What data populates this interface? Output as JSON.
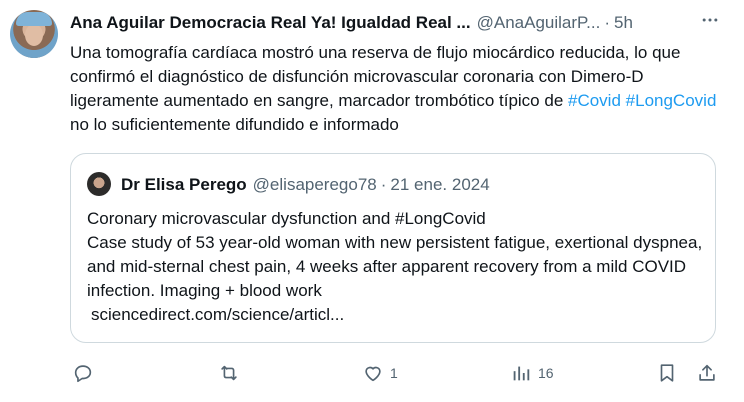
{
  "author": {
    "name": "Ana Aguilar Democracia Real Ya! Igualdad Real ...",
    "handle": "@AnaAguilarP...",
    "separator": "·",
    "time": "5h"
  },
  "tweet": {
    "text_part1": "Una tomografía cardíaca mostró una reserva de flujo miocárdico reducida, lo que confirmó el diagnóstico de disfunción microvascular coronaria con Dimero-D ligeramente aumentado en sangre, marcador trombótico típico de ",
    "hashtag1": "#Covid",
    "space": " ",
    "hashtag2": "#LongCovid",
    "text_part2": " no lo suficientemente difundido e informado"
  },
  "quoted": {
    "name": "Dr Elisa Perego",
    "handle": "@elisaperego78",
    "separator": "·",
    "date": "21 ene. 2024",
    "line1": "Coronary microvascular dysfunction and #LongCovid",
    "line2": "Case study of 53 year-old woman with new persistent fatigue, exertional dyspnea, and mid-sternal chest pain, 4 weeks after apparent recovery from a mild COVID infection. Imaging + blood work",
    "link": "sciencedirect.com/science/articl..."
  },
  "actions": {
    "reply_count": "",
    "retweet_count": "",
    "like_count": "1",
    "views_count": "16"
  },
  "colors": {
    "link": "#1d9bf0",
    "secondary_text": "#536471",
    "border": "#cfd9de"
  }
}
